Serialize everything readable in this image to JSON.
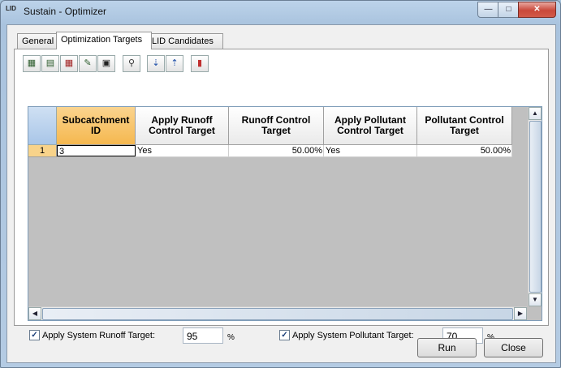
{
  "window": {
    "title": "Sustain - Optimizer",
    "icon_text": "LID",
    "controls": {
      "minimize": "—",
      "maximize": "□",
      "close": "✕"
    }
  },
  "tabs": [
    {
      "label": "General",
      "active": false
    },
    {
      "label": "Optimization Targets",
      "active": true
    },
    {
      "label": "LID Candidates",
      "active": false
    }
  ],
  "toolbar": {
    "buttons": [
      {
        "name": "add-row-button",
        "icon": "table-add-icon"
      },
      {
        "name": "insert-row-button",
        "icon": "table-insert-icon"
      },
      {
        "name": "delete-row-button",
        "icon": "table-delete-icon"
      },
      {
        "name": "edit-row-button",
        "icon": "table-edit-icon"
      },
      {
        "name": "save-button",
        "icon": "floppy-disk-icon"
      },
      {
        "name": "find-button",
        "icon": "magnifier-icon"
      },
      {
        "name": "sort-ascending-button",
        "icon": "sort-down-icon"
      },
      {
        "name": "sort-descending-button",
        "icon": "sort-up-icon"
      },
      {
        "name": "chart-button",
        "icon": "chart-icon"
      }
    ]
  },
  "grid": {
    "columns": [
      "Subcatchment ID",
      "Apply Runoff Control Target",
      "Runoff Control Target",
      "Apply Pollutant Control Target",
      "Pollutant Control Target"
    ],
    "rows": [
      {
        "num": "1",
        "cells": [
          "3",
          "Yes",
          "50.00%",
          "Yes",
          "50.00%"
        ]
      }
    ]
  },
  "system_targets": {
    "runoff_label": "Apply System Runoff Target:",
    "runoff_checked": true,
    "runoff_value": "95",
    "runoff_unit": "%",
    "pollutant_label": "Apply System Pollutant Target:",
    "pollutant_checked": true,
    "pollutant_value": "70",
    "pollutant_unit": "%"
  },
  "buttons": {
    "run": "Run",
    "close": "Close"
  }
}
